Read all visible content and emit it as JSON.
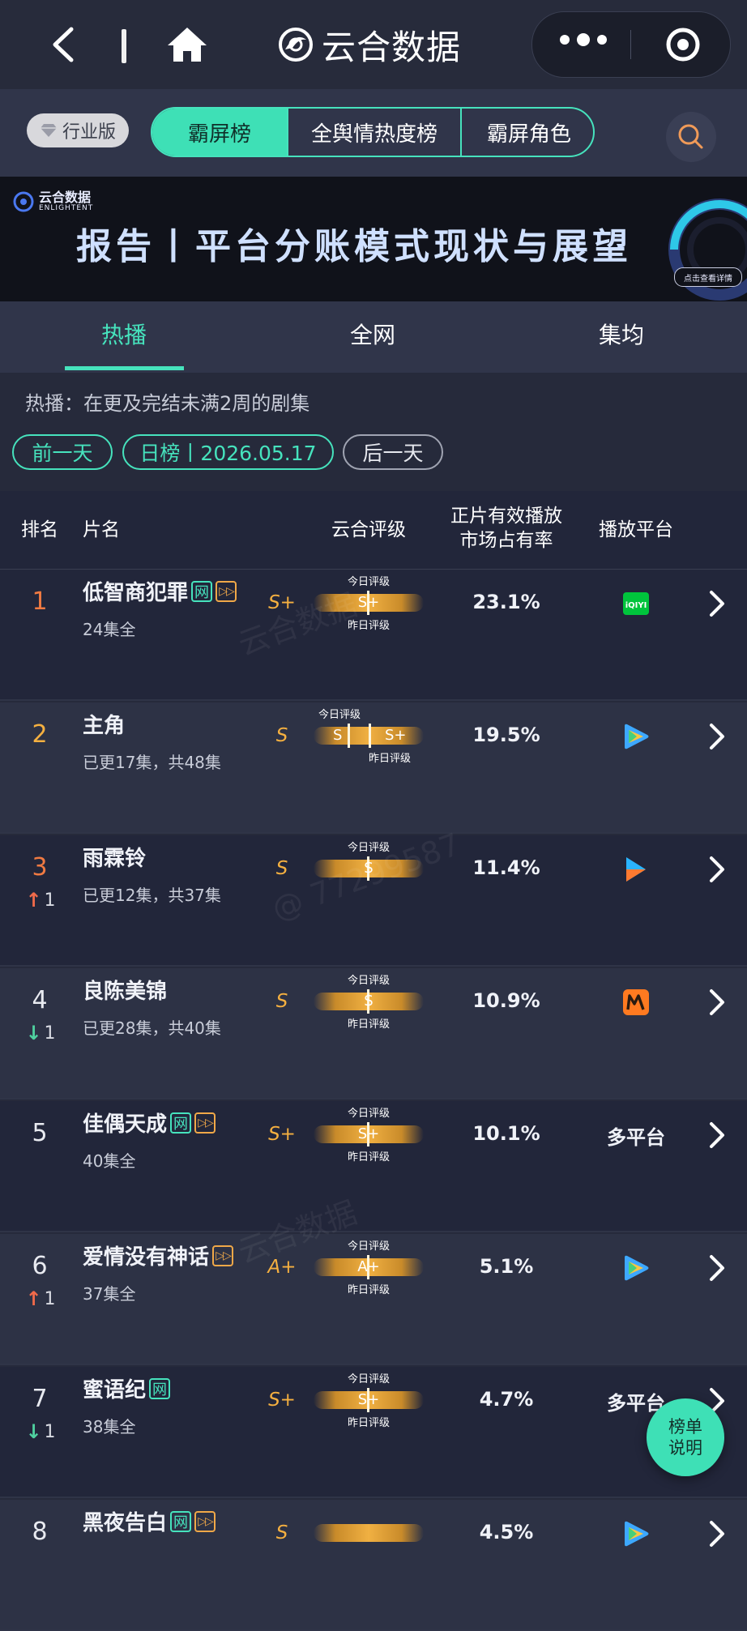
{
  "nav": {
    "title": "云合数据"
  },
  "toolbar": {
    "industry_label": "行业版",
    "tabs": [
      {
        "label": "霸屏榜",
        "active": true
      },
      {
        "label": "全舆情热度榜",
        "active": false
      },
      {
        "label": "霸屏角色",
        "active": false
      }
    ]
  },
  "banner": {
    "logo_cn": "云合数据",
    "logo_en": "ENLIGHTENT",
    "title": "报告丨平台分账模式现状与展望",
    "cta": "点击查看详情"
  },
  "subtabs": [
    {
      "label": "热播",
      "active": true
    },
    {
      "label": "全网",
      "active": false
    },
    {
      "label": "集均",
      "active": false
    }
  ],
  "hint": "热播：在更及完结未满2周的剧集",
  "date_nav": {
    "prev": "前一天",
    "current": "日榜丨2026.05.17",
    "next": "后一天"
  },
  "table": {
    "headers": {
      "rank": "排名",
      "title": "片名",
      "rating": "云合评级",
      "share_line1": "正片有效播放",
      "share_line2": "市场占有率",
      "platform": "播放平台"
    },
    "today_label": "今日评级",
    "yesterday_label": "昨日评级",
    "rows": [
      {
        "rank": "1",
        "title": "低智商犯罪",
        "tag_net": "网",
        "tag_vip": true,
        "episodes": "24集全",
        "grade": "S+",
        "today": "S+",
        "yesterday": "",
        "share": "23.1%",
        "platform": "iqiyi",
        "platform_text": "",
        "trend": "",
        "trend_value": ""
      },
      {
        "rank": "2",
        "title": "主角",
        "tag_net": "",
        "tag_vip": false,
        "episodes": "已更17集，共48集",
        "grade": "S",
        "today": "S",
        "yesterday": "S+",
        "share": "19.5%",
        "platform": "tencent",
        "platform_text": "",
        "trend": "",
        "trend_value": ""
      },
      {
        "rank": "3",
        "title": "雨霖铃",
        "tag_net": "",
        "tag_vip": false,
        "episodes": "已更12集，共37集",
        "grade": "S",
        "today": "S",
        "yesterday": "",
        "share": "11.4%",
        "platform": "youku",
        "platform_text": "",
        "trend": "up",
        "trend_value": "1"
      },
      {
        "rank": "4",
        "title": "良陈美锦",
        "tag_net": "",
        "tag_vip": false,
        "episodes": "已更28集，共40集",
        "grade": "S",
        "today": "S",
        "yesterday": "",
        "share": "10.9%",
        "platform": "mango",
        "platform_text": "",
        "trend": "down",
        "trend_value": "1"
      },
      {
        "rank": "5",
        "title": "佳偶天成",
        "tag_net": "网",
        "tag_vip": true,
        "episodes": "40集全",
        "grade": "S+",
        "today": "S+",
        "yesterday": "",
        "share": "10.1%",
        "platform": "multi",
        "platform_text": "多平台",
        "trend": "",
        "trend_value": ""
      },
      {
        "rank": "6",
        "title": "爱情没有神话",
        "tag_net": "",
        "tag_vip": true,
        "episodes": "37集全",
        "grade": "A+",
        "today": "A+",
        "yesterday": "",
        "share": "5.1%",
        "platform": "tencent",
        "platform_text": "",
        "trend": "up",
        "trend_value": "1"
      },
      {
        "rank": "7",
        "title": "蜜语纪",
        "tag_net": "网",
        "tag_vip": false,
        "episodes": "38集全",
        "grade": "S+",
        "today": "S+",
        "yesterday": "",
        "share": "4.7%",
        "platform": "multi",
        "platform_text": "多平台",
        "trend": "down",
        "trend_value": "1"
      },
      {
        "rank": "8",
        "title": "黑夜告白",
        "tag_net": "网",
        "tag_vip": true,
        "episodes": "",
        "grade": "S",
        "today": "",
        "yesterday": "",
        "share": "4.5%",
        "platform": "tencent",
        "platform_text": "",
        "trend": "",
        "trend_value": ""
      }
    ]
  },
  "help_button": {
    "line1": "榜单",
    "line2": "说明"
  },
  "colors": {
    "accent": "#3ee0b6",
    "gold": "#f5b040",
    "bg": "#262a3b"
  }
}
